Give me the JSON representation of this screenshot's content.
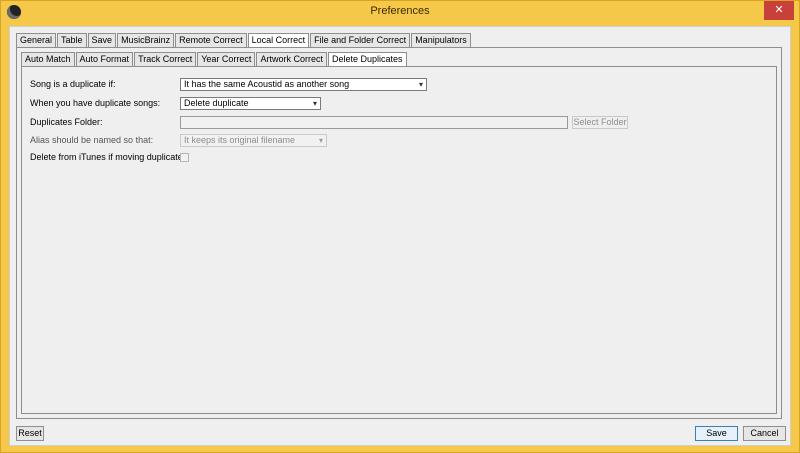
{
  "window": {
    "title": "Preferences",
    "close_glyph": "✕",
    "app_icon": "songkong-icon"
  },
  "outer_tabs": [
    "General",
    "Table",
    "Save",
    "MusicBrainz",
    "Remote Correct",
    "Local Correct",
    "File and Folder Correct",
    "Manipulators"
  ],
  "outer_active": "Local Correct",
  "inner_tabs": [
    "Auto Match",
    "Auto Format",
    "Track Correct",
    "Year Correct",
    "Artwork Correct",
    "Delete Duplicates"
  ],
  "inner_active": "Delete Duplicates",
  "form": {
    "duplicate_if_label": "Song is a duplicate if:",
    "duplicate_if_value": "It has the same Acoustid as another song",
    "when_duplicates_label": "When you have duplicate songs:",
    "when_duplicates_value": "Delete duplicate",
    "folder_label": "Duplicates Folder:",
    "folder_value": "",
    "select_folder_label": "Select Folder",
    "alias_label": "Alias should be named so that:",
    "alias_value": "It keeps its original filename",
    "itunes_label": "Delete from iTunes if moving duplicates:",
    "itunes_checked": false
  },
  "buttons": {
    "reset": "Reset",
    "save": "Save",
    "cancel": "Cancel"
  },
  "icons": {
    "dropdown": "▾"
  }
}
